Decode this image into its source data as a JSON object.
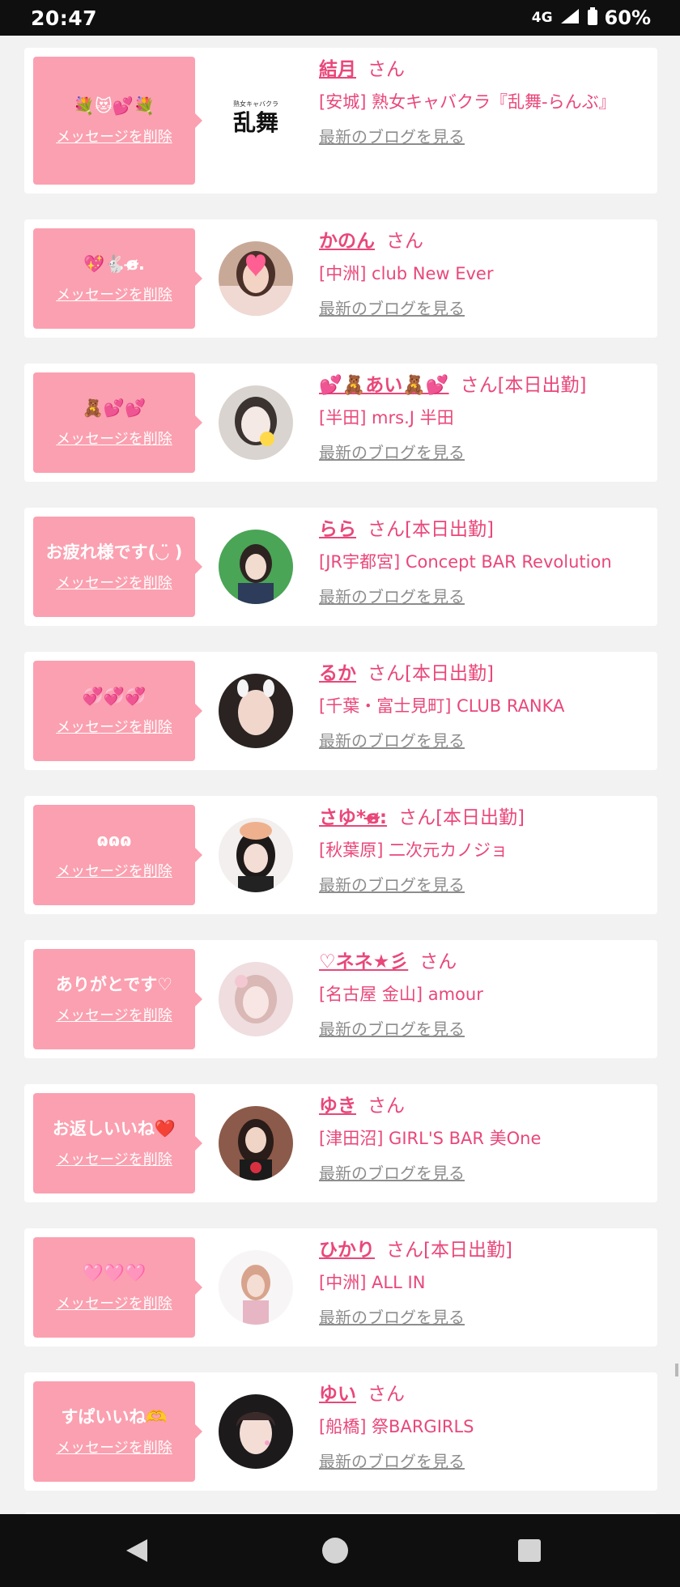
{
  "status": {
    "time": "20:47",
    "network": "4G",
    "battery": "60%"
  },
  "cards": [
    {
      "message": "💐😻💕💐",
      "delete": "メッセージを削除",
      "name": "結月",
      "honorific": "さん",
      "tag": "",
      "shop": "[安城] 熟女キャバクラ『乱舞-らんぶ』",
      "blog": "最新のブログを見る"
    },
    {
      "message": "💖🐇ɞ̴̶̷.",
      "delete": "メッセージを削除",
      "name": "かのん",
      "honorific": "さん",
      "tag": "",
      "shop": "[中洲] club New Ever",
      "blog": "最新のブログを見る"
    },
    {
      "message": "🧸💕💕",
      "delete": "メッセージを削除",
      "name": "💕🧸あい🧸💕",
      "honorific": "さん",
      "tag": "[本日出勤]",
      "shop": "[半田] mrs.J 半田",
      "blog": "最新のブログを見る"
    },
    {
      "message": "お疲れ様です(◡̈ )",
      "delete": "メッセージを削除",
      "name": "らら",
      "honorific": "さん",
      "tag": "[本日出勤]",
      "shop": "[JR宇都宮] Concept BAR Revolution",
      "blog": "最新のブログを見る"
    },
    {
      "message": "💞💞💞",
      "delete": "メッセージを削除",
      "name": "るか",
      "honorific": "さん",
      "tag": "[本日出勤]",
      "shop": "[千葉・富士見町] CLUB RANKA",
      "blog": "最新のブログを見る"
    },
    {
      "message": "ɷɷɷ",
      "delete": "メッセージを削除",
      "name": "さゆ*ɞ̴̶̷:",
      "honorific": "さん",
      "tag": "[本日出勤]",
      "shop": "[秋葉原] 二次元カノジョ",
      "blog": "最新のブログを見る"
    },
    {
      "message": "ありがとです♡",
      "delete": "メッセージを削除",
      "name": "♡ネネ★彡",
      "honorific": "さん",
      "tag": "",
      "shop": "[名古屋 金山] amour",
      "blog": "最新のブログを見る"
    },
    {
      "message": "お返しいいね❤️",
      "delete": "メッセージを削除",
      "name": "ゆき",
      "honorific": "さん",
      "tag": "",
      "shop": "[津田沼] GIRL'S BAR 美One",
      "blog": "最新のブログを見る"
    },
    {
      "message": "🩷🩷🩷",
      "delete": "メッセージを削除",
      "name": "ひかり",
      "honorific": "さん",
      "tag": "[本日出勤]",
      "shop": "[中洲] ALL IN",
      "blog": "最新のブログを見る"
    },
    {
      "message": "すぱいいね🫶",
      "delete": "メッセージを削除",
      "name": "ゆい",
      "honorific": "さん",
      "tag": "",
      "shop": "[船橋] 祭BARGIRLS",
      "blog": "最新のブログを見る"
    }
  ],
  "nav": {
    "back": "back-icon",
    "home": "home-icon",
    "recents": "recents-icon"
  },
  "colors": {
    "accent": "#e9477a",
    "message_bg": "#fba0b0",
    "link_gray": "#8d8d8d"
  }
}
